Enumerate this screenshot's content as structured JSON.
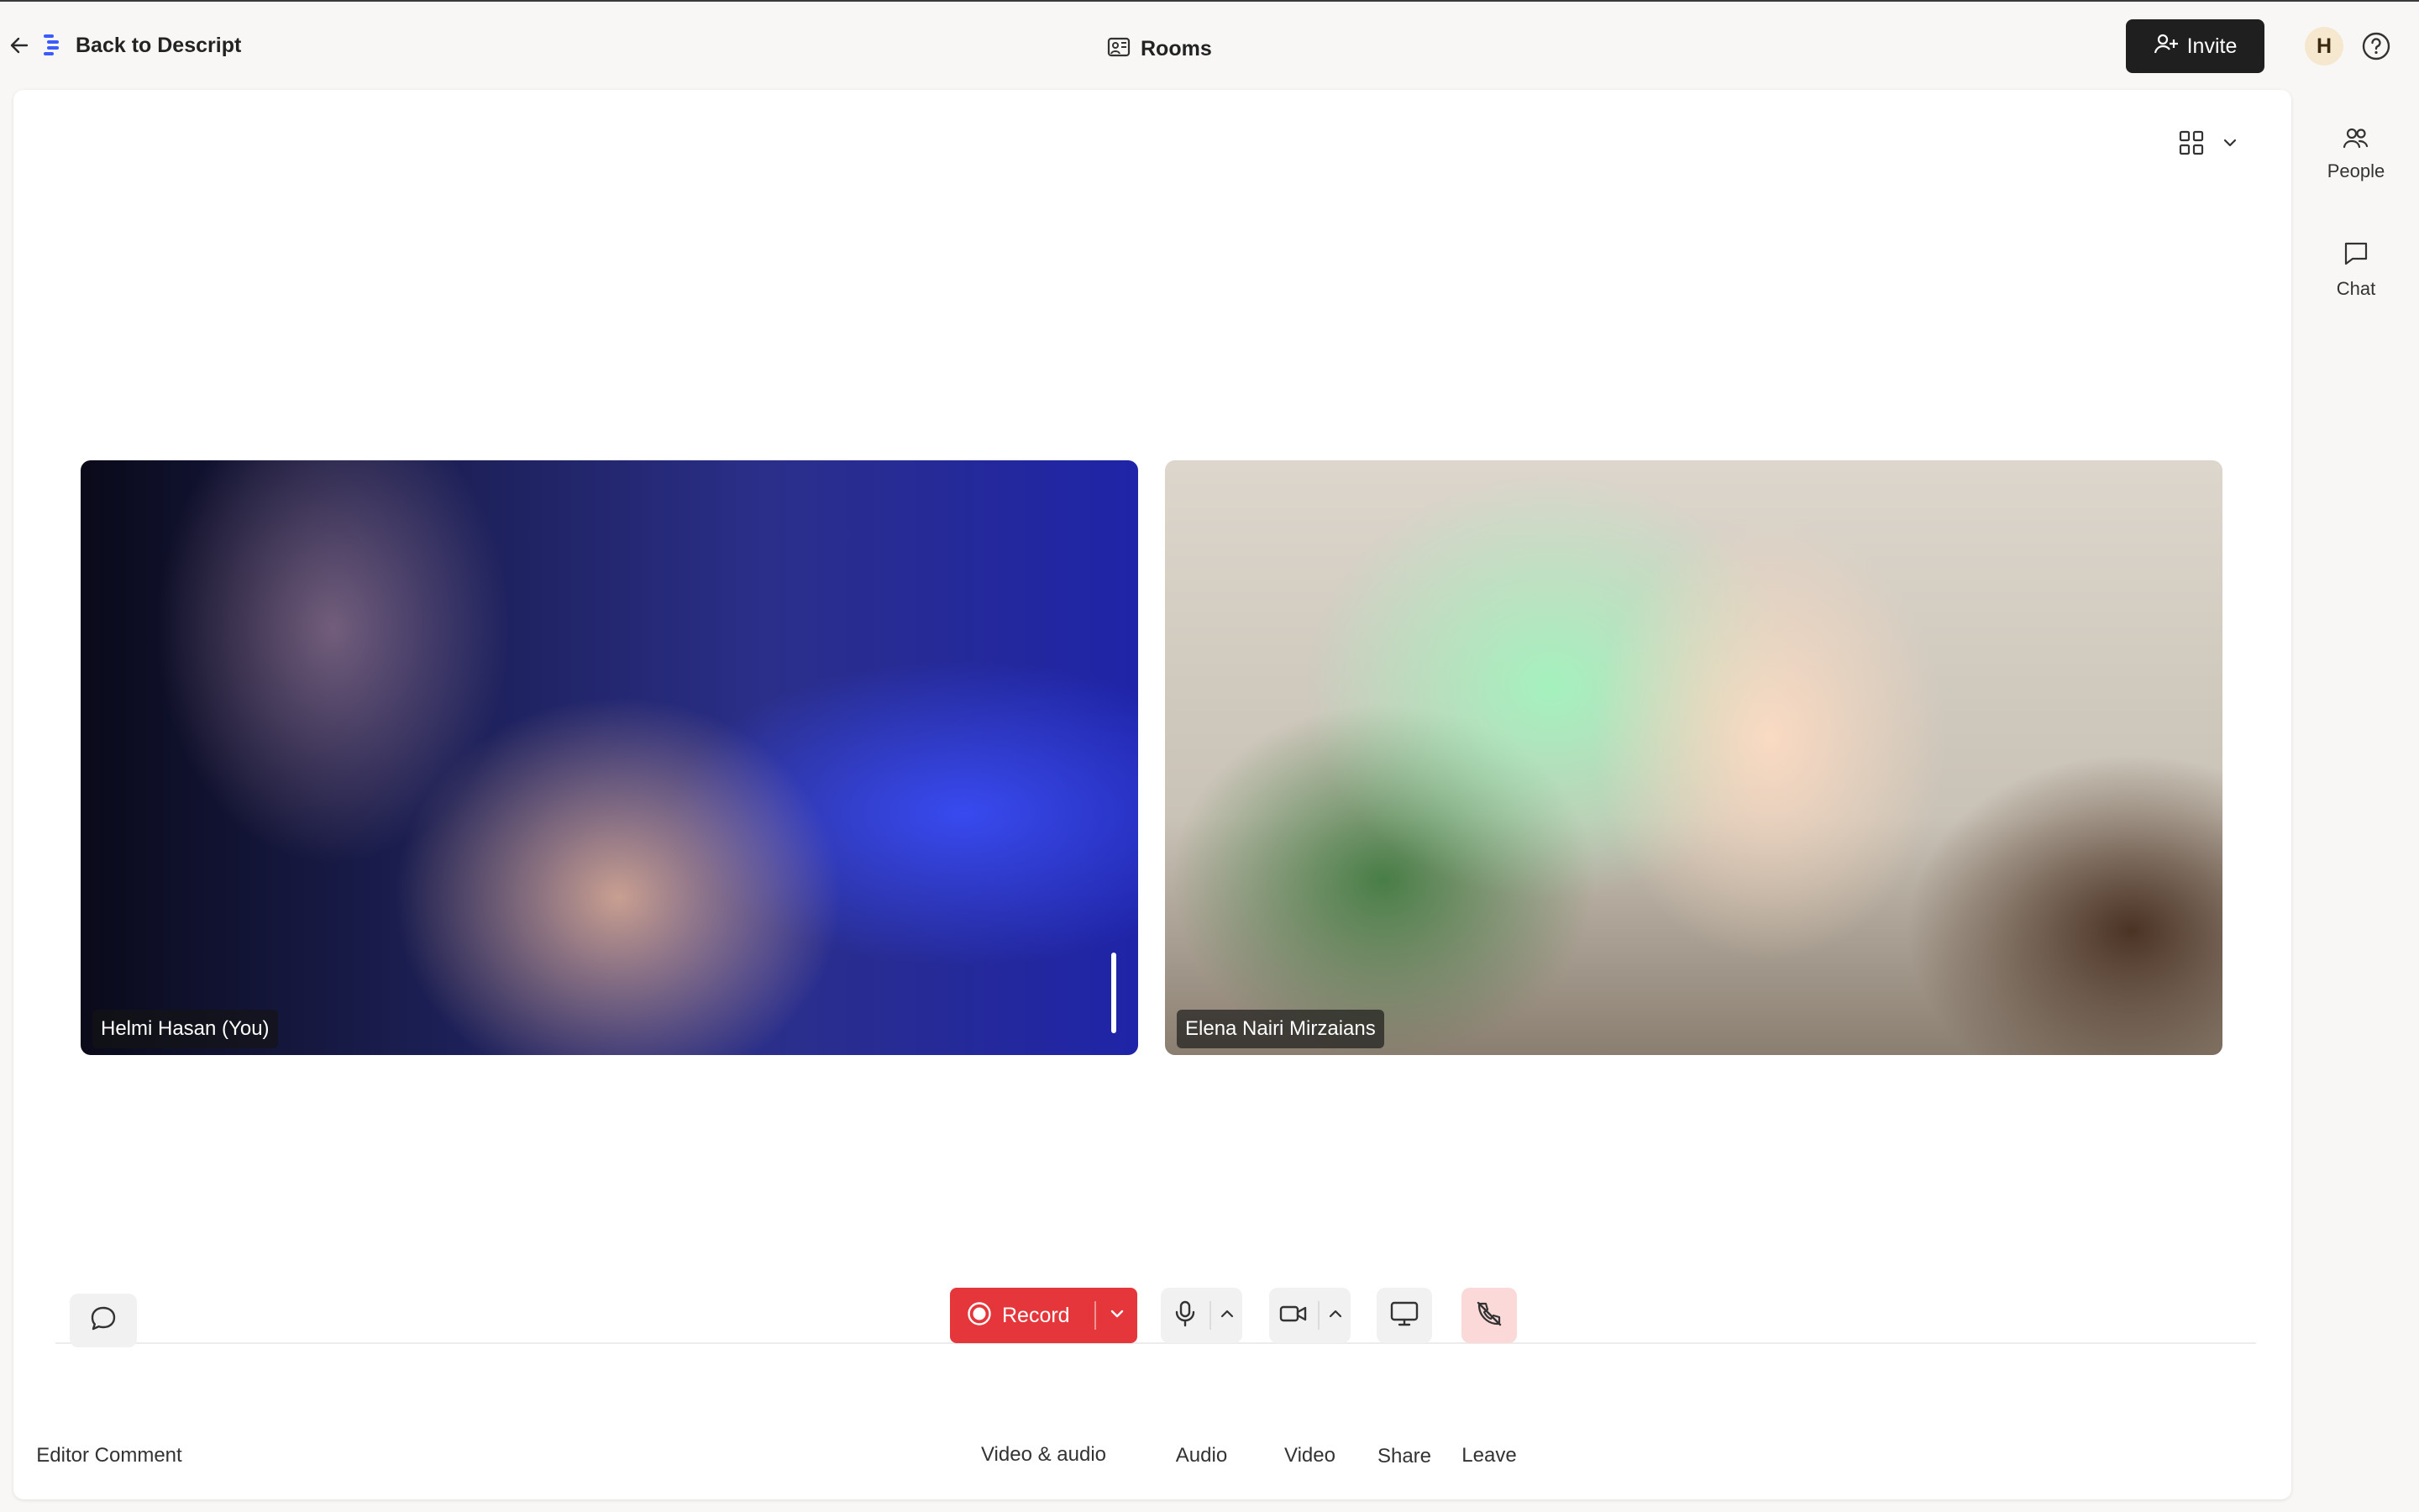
{
  "header": {
    "back_label": "Back to Descript",
    "title": "Rooms",
    "invite_label": "Invite",
    "avatar_initial": "H"
  },
  "participants": [
    {
      "name": "Helmi Hasan (You)"
    },
    {
      "name": "Elena Nairi Mirzaians"
    }
  ],
  "controls": {
    "editor_comment_label": "Editor Comment",
    "record_label": "Record",
    "record_mode_label": "Video & audio",
    "audio_label": "Audio",
    "video_label": "Video",
    "share_label": "Share",
    "leave_label": "Leave"
  },
  "sidebar": {
    "items": [
      {
        "label": "People",
        "icon": "people-icon"
      },
      {
        "label": "Chat",
        "icon": "chat-icon"
      }
    ]
  },
  "colors": {
    "record": "#e5373b",
    "invite_bg": "#1f1f1f",
    "leave_bg": "#fbd9d9",
    "avatar_bg": "#f6e8cf",
    "descript_logo": "#3b5bff"
  }
}
